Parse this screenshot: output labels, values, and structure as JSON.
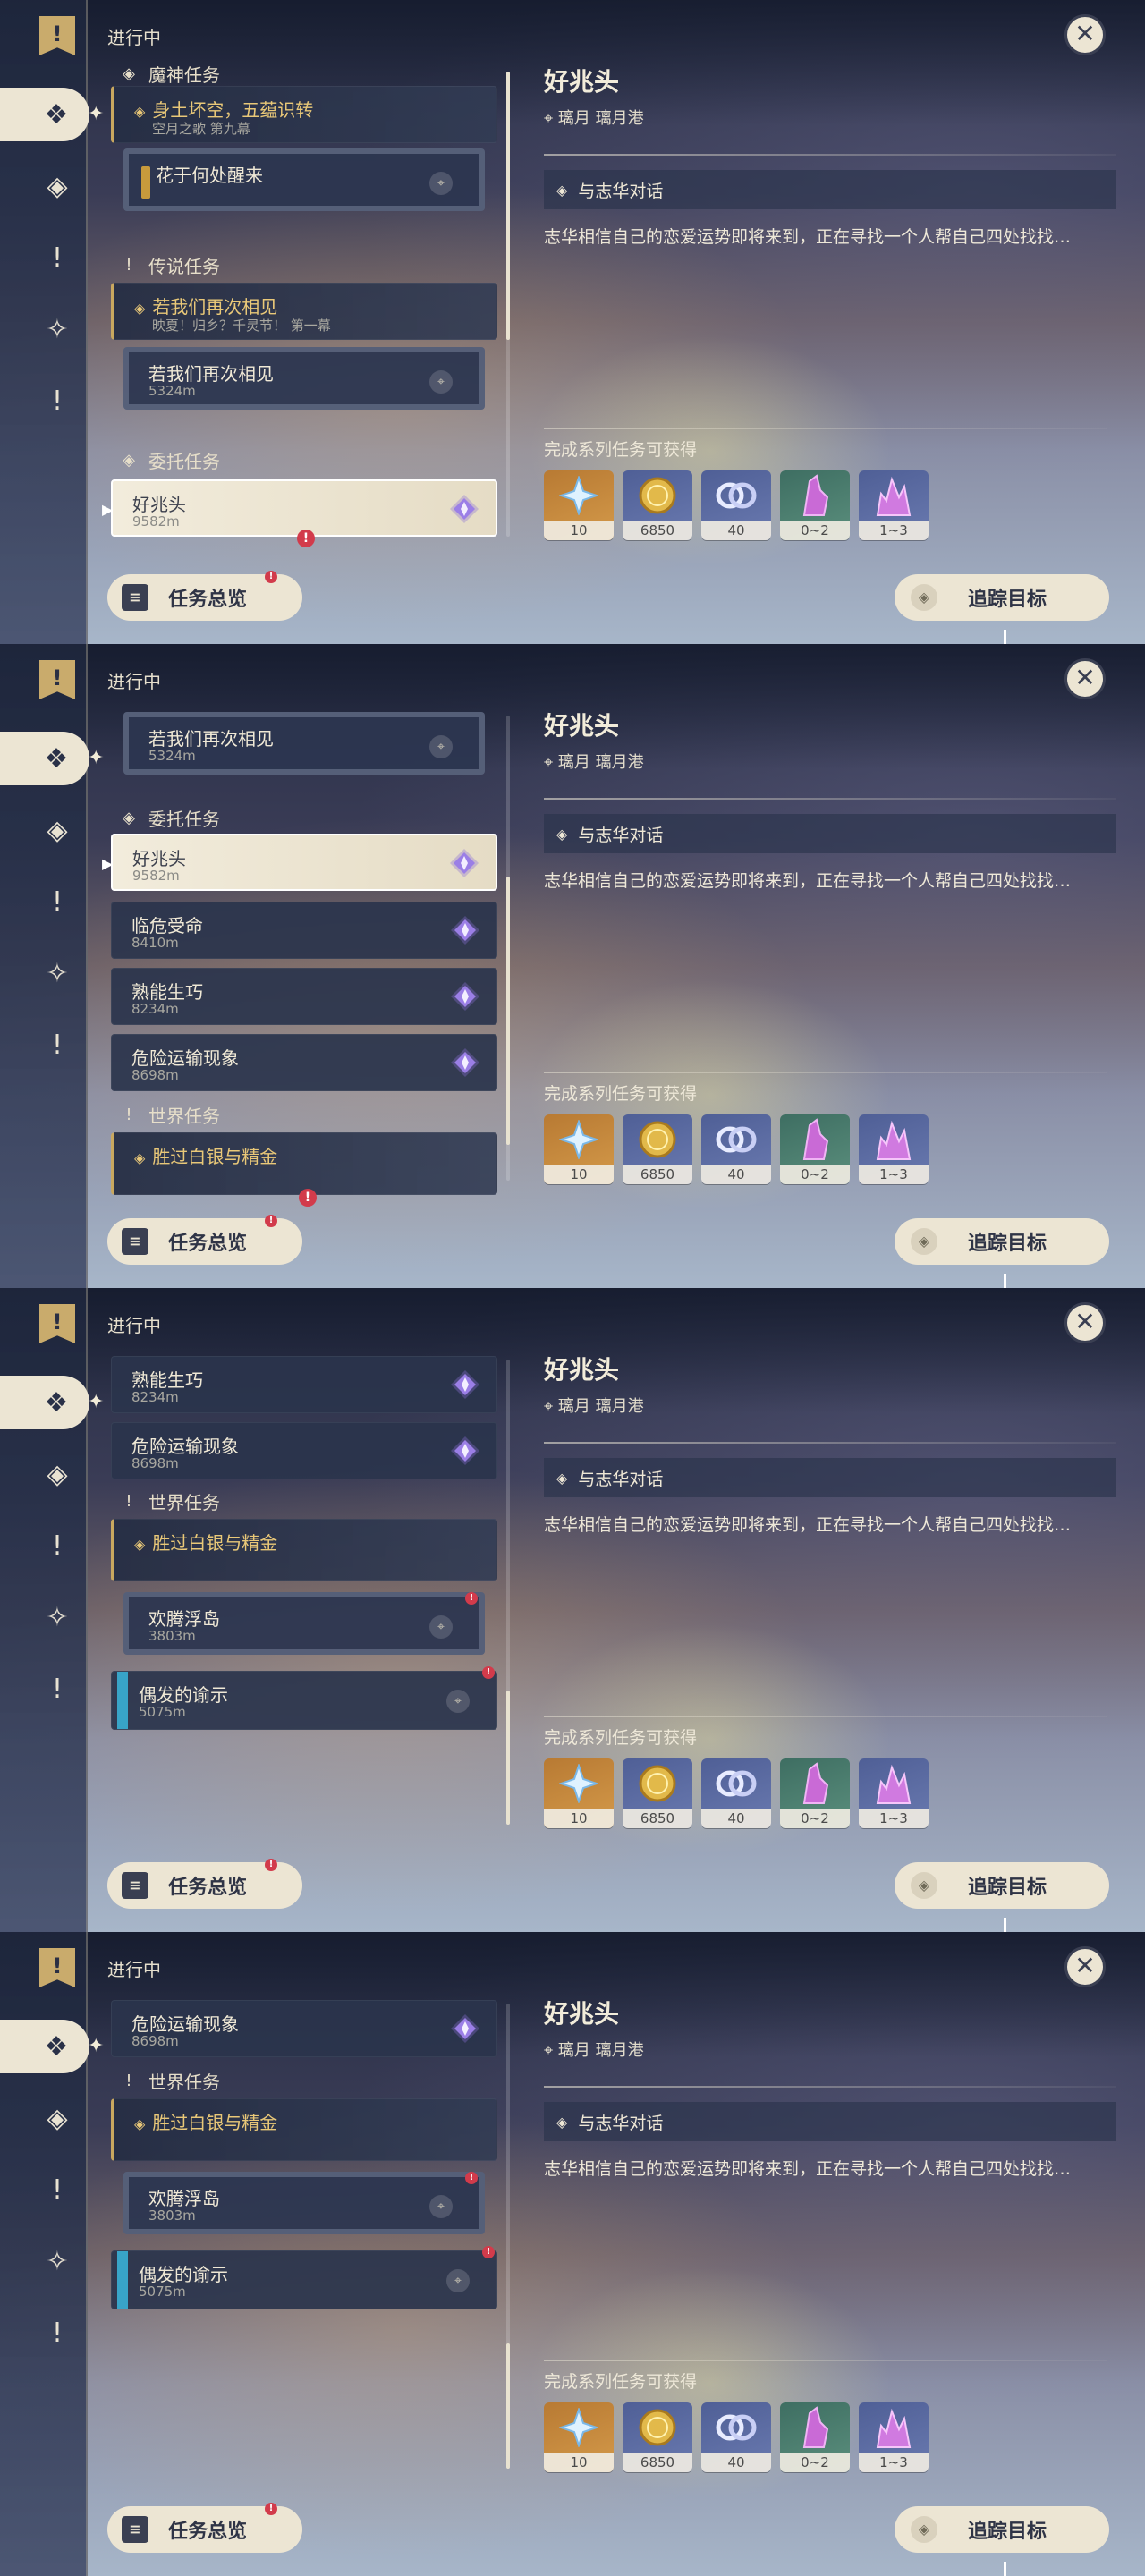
{
  "ui": {
    "status": "进行中",
    "close_icon": "✕",
    "rail_icons": [
      "quest-banner-icon",
      "archon-quest-icon",
      "legend-quest-icon",
      "exclamation-icon",
      "commission-icon",
      "exclamation-icon"
    ],
    "overview_button": "任务总览",
    "track_button": "追踪目标"
  },
  "sections": {
    "archon": "魔神任务",
    "legend": "传说任务",
    "commission": "委托任务",
    "world": "世界任务"
  },
  "quests": {
    "archon_chapter": {
      "title": "身土坏空，五蕴识转",
      "subtitle": "空月之歌 第九幕"
    },
    "archon_step": {
      "title": "花于何处醒来"
    },
    "legend_chapter": {
      "title": "若我们再次相见",
      "subtitle": "映夏！归乡？千灵节！ 第一幕"
    },
    "legend_step": {
      "title": "若我们再次相见",
      "distance": "5324m"
    },
    "haozhaotou": {
      "title": "好兆头",
      "distance": "9582m"
    },
    "linwei": {
      "title": "临危受命",
      "distance": "8410m"
    },
    "shuneng": {
      "title": "熟能生巧",
      "distance": "8234m"
    },
    "weixian": {
      "title": "危险运输现象",
      "distance": "8698m"
    },
    "world_chapter": {
      "title": "胜过白银与精金"
    },
    "huanteng": {
      "title": "欢腾浮岛",
      "distance": "3803m"
    },
    "oufa": {
      "title": "偶发的谕示",
      "distance": "5075m"
    }
  },
  "detail": {
    "title": "好兆头",
    "location": "璃月 璃月港",
    "objective": "与志华对话",
    "description": "志华相信自己的恋爱运势即将来到，正在寻找一个人帮自己四处找找…",
    "rewards_label": "完成系列任务可获得",
    "rewards": [
      {
        "name": "adventure-exp",
        "count": "10",
        "color": "orange"
      },
      {
        "name": "mora",
        "count": "6850",
        "color": "blue"
      },
      {
        "name": "companionship-exp",
        "count": "40",
        "color": "blue"
      },
      {
        "name": "purple-ore",
        "count": "0~2",
        "color": "green"
      },
      {
        "name": "purple-crystal",
        "count": "1~3",
        "color": "blue"
      }
    ]
  },
  "colors": {
    "accent_cream": "#ece5d3",
    "gold": "#e9c878",
    "alert": "#d23b4b",
    "commission_purple": "#8a6fd6"
  },
  "scroll_progress": [
    0.0,
    0.35,
    0.72,
    1.0
  ]
}
